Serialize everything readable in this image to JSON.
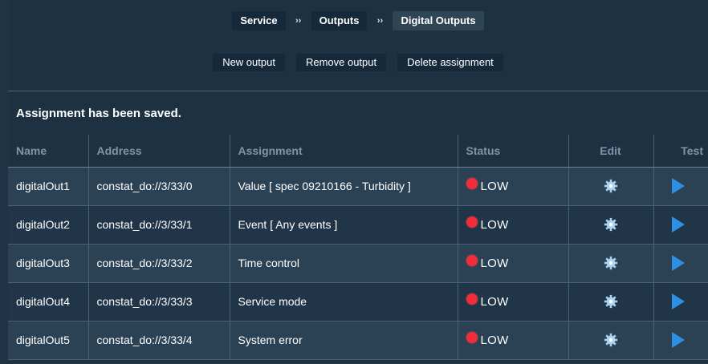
{
  "breadcrumb": {
    "items": [
      {
        "label": "Service"
      },
      {
        "label": "Outputs"
      },
      {
        "label": "Digital Outputs"
      }
    ],
    "separator": "››"
  },
  "toolbar": {
    "new_output": "New output",
    "remove_output": "Remove output",
    "delete_assignment": "Delete assignment"
  },
  "message": "Assignment has been saved.",
  "table": {
    "headers": {
      "name": "Name",
      "address": "Address",
      "assignment": "Assignment",
      "status": "Status",
      "edit": "Edit",
      "test": "Test"
    },
    "rows": [
      {
        "name": "digitalOut1",
        "address": "constat_do://3/33/0",
        "assignment": "Value [ spec 09210166 - Turbidity ]",
        "status": "LOW"
      },
      {
        "name": "digitalOut2",
        "address": "constat_do://3/33/1",
        "assignment": "Event [ Any events ]",
        "status": "LOW"
      },
      {
        "name": "digitalOut3",
        "address": "constat_do://3/33/2",
        "assignment": "Time control",
        "status": "LOW"
      },
      {
        "name": "digitalOut4",
        "address": "constat_do://3/33/3",
        "assignment": "Service mode",
        "status": "LOW"
      },
      {
        "name": "digitalOut5",
        "address": "constat_do://3/33/4",
        "assignment": "System error",
        "status": "LOW"
      }
    ]
  },
  "icons": {
    "status_dot": "red-status-dot-icon",
    "edit": "gear-icon",
    "test": "play-icon"
  },
  "colors": {
    "background": "#1f3344",
    "status_low": "#f12c3c",
    "test_accent": "#2c8fe0",
    "header_text": "#7f94a6"
  }
}
